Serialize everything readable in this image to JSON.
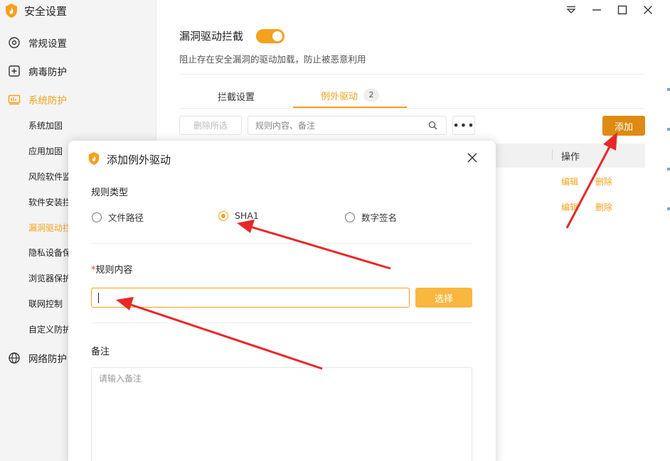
{
  "app": {
    "title": "安全设置"
  },
  "window": {
    "icons": [
      "menu-icon",
      "minimize-icon",
      "maximize-icon",
      "close-icon"
    ]
  },
  "sidebar": {
    "items": [
      {
        "label": "常规设置",
        "icon": "gear-icon"
      },
      {
        "label": "病毒防护",
        "icon": "plus-square-icon"
      },
      {
        "label": "系统防护",
        "icon": "system-icon",
        "active": true
      },
      {
        "label": "网络防护",
        "icon": "globe-icon"
      }
    ],
    "sub_items": [
      {
        "label": "系统加固"
      },
      {
        "label": "应用加固"
      },
      {
        "label": "风险软件监控"
      },
      {
        "label": "软件安装拦截"
      },
      {
        "label": "漏洞驱动拦截",
        "active": true
      },
      {
        "label": "隐私设备保护"
      },
      {
        "label": "浏览器保护"
      },
      {
        "label": "联网控制"
      },
      {
        "label": "自定义防护"
      }
    ]
  },
  "main": {
    "title": "漏洞驱动拦截",
    "toggle_on": true,
    "description": "阻止存在安全漏洞的驱动加载，防止被恶意利用",
    "tabs": [
      {
        "label": "拦截设置"
      },
      {
        "label": "例外驱动",
        "badge": "2",
        "active": true
      }
    ],
    "toolbar": {
      "delete_selected": "删除所选",
      "search_placeholder": "规则内容、备注",
      "more": "•••",
      "add": "添加"
    },
    "table": {
      "ops_header": "操作",
      "rows": [
        {
          "edit": "编辑",
          "delete": "删除"
        },
        {
          "edit": "编辑",
          "delete": "删除"
        }
      ]
    }
  },
  "dialog": {
    "title": "添加例外驱动",
    "rule_type_label": "规则类型",
    "rule_types": [
      {
        "label": "文件路径",
        "checked": false
      },
      {
        "label": "SHA1",
        "checked": true
      },
      {
        "label": "数字签名",
        "checked": false
      }
    ],
    "rule_content_required": "*",
    "rule_content_label": "规则内容",
    "rule_content_value": "",
    "select_button": "选择",
    "remark_label": "备注",
    "remark_placeholder": "请输入备注"
  },
  "colors": {
    "accent": "#f4a11c",
    "add_button": "#dd8b12",
    "arrow": "#e82828"
  }
}
